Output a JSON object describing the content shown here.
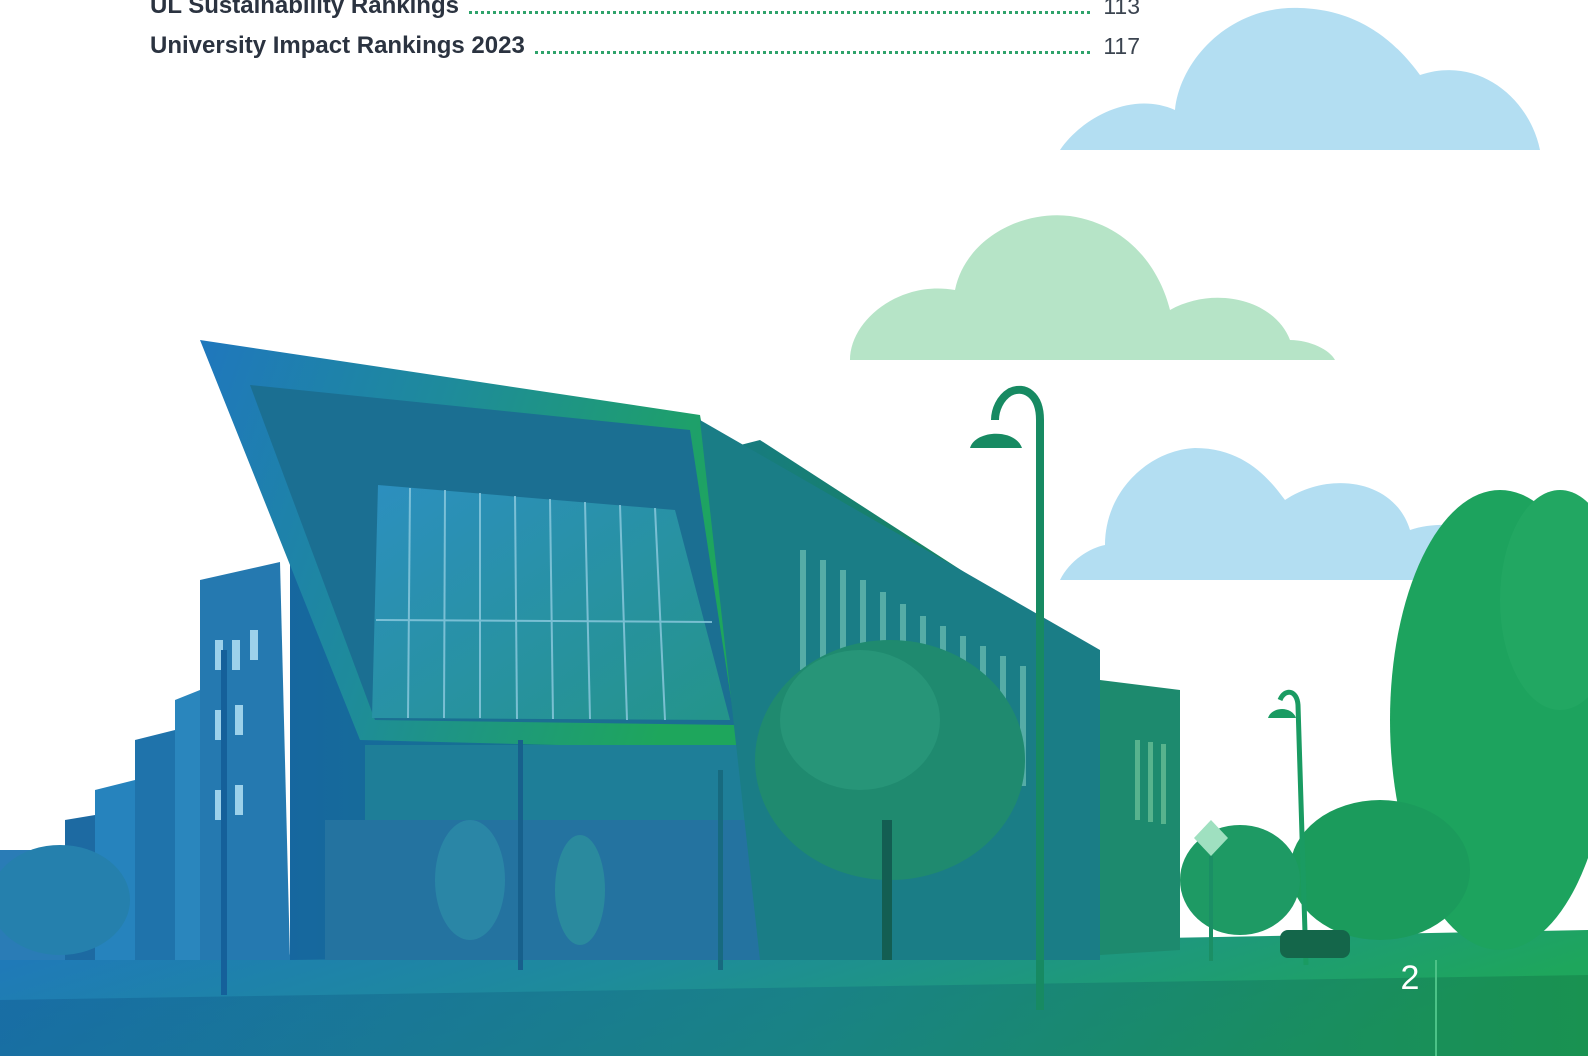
{
  "toc": {
    "entries": [
      {
        "label": "UL Sustainability Rankings",
        "page": "113"
      },
      {
        "label": "University Impact Rankings 2023",
        "page": "117"
      }
    ]
  },
  "colors": {
    "toc_text": "#2b3340",
    "dot_leader": "#2fa36b",
    "cloud_blue": "#b3def2",
    "cloud_green": "#b6e4c7",
    "gradient_blue": "#2479b8",
    "gradient_green": "#1fa35c"
  },
  "page_number": "2"
}
